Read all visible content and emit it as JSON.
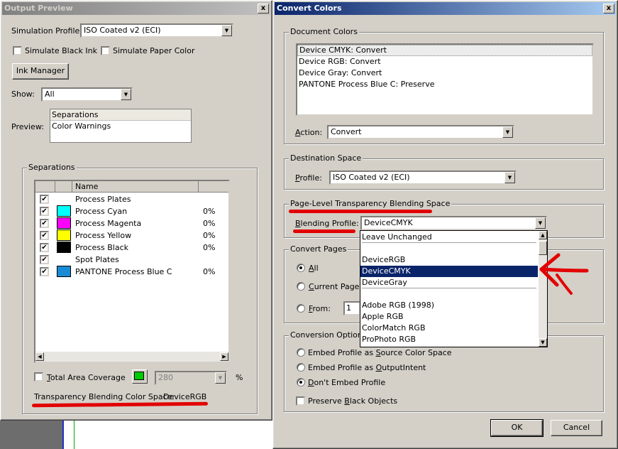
{
  "output_preview": {
    "title": "Output Preview",
    "close": "x",
    "simulation_profile_label": "Simulation Profile:",
    "simulation_profile_value": "ISO Coated v2 (ECI)",
    "simulate_black_ink": "Simulate Black Ink",
    "simulate_paper_color": "Simulate Paper Color",
    "ink_manager": "Ink Manager",
    "show_label": "Show:",
    "show_value": "All",
    "preview_label": "Preview:",
    "preview_options": [
      "Separations",
      "Color Warnings"
    ],
    "separations_group": "Separations",
    "table_header": "Name",
    "separations": [
      {
        "name": "Process Plates",
        "pct": "",
        "color": ""
      },
      {
        "name": "Process Cyan",
        "pct": "0%",
        "color": "#00ffff"
      },
      {
        "name": "Process Magenta",
        "pct": "0%",
        "color": "#ff00ff"
      },
      {
        "name": "Process Yellow",
        "pct": "0%",
        "color": "#ffff00"
      },
      {
        "name": "Process Black",
        "pct": "0%",
        "color": "#000000"
      },
      {
        "name": "Spot Plates",
        "pct": "",
        "color": ""
      },
      {
        "name": "PANTONE Process Blue C",
        "pct": "0%",
        "color": "#1a8ad4"
      }
    ],
    "total_area_coverage": "Total Area Coverage",
    "coverage_value": "280",
    "pct_sign": "%",
    "tbcs_label": "Transparency Blending Color Space:",
    "tbcs_value": "DeviceRGB",
    "coverage_swatch_color": "#00cc00"
  },
  "convert_colors": {
    "title": "Convert Colors",
    "close": "x",
    "document_colors_group": "Document Colors",
    "document_colors": [
      "Device CMYK: Convert",
      "Device RGB: Convert",
      "Device Gray: Convert",
      "PANTONE Process Blue C: Preserve"
    ],
    "action_label": "Action:",
    "action_value": "Convert",
    "destination_group": "Destination Space",
    "profile_label": "Profile:",
    "profile_value": "ISO Coated v2 (ECI)",
    "blending_group": "Page-Level Transparency Blending Space",
    "blending_label": "Blending Profile:",
    "blending_value": "DeviceCMYK",
    "blending_options": [
      "Leave Unchanged",
      "",
      "DeviceRGB",
      "DeviceCMYK",
      "DeviceGray",
      "",
      "Adobe RGB (1998)",
      "Apple RGB",
      "ColorMatch RGB",
      "ProPhoto RGB"
    ],
    "convert_pages_group": "Convert Pages",
    "all": "All",
    "current_page": "Current Page",
    "from": "From:",
    "from_value": "1",
    "conversion_options_group": "Conversion Options",
    "embed_source": "Embed Profile as Source Color Space",
    "embed_output": "Embed Profile as OutputIntent",
    "dont_embed": "Don't Embed Profile",
    "preserve_black": "Preserve Black Objects",
    "ok": "OK",
    "cancel": "Cancel"
  }
}
